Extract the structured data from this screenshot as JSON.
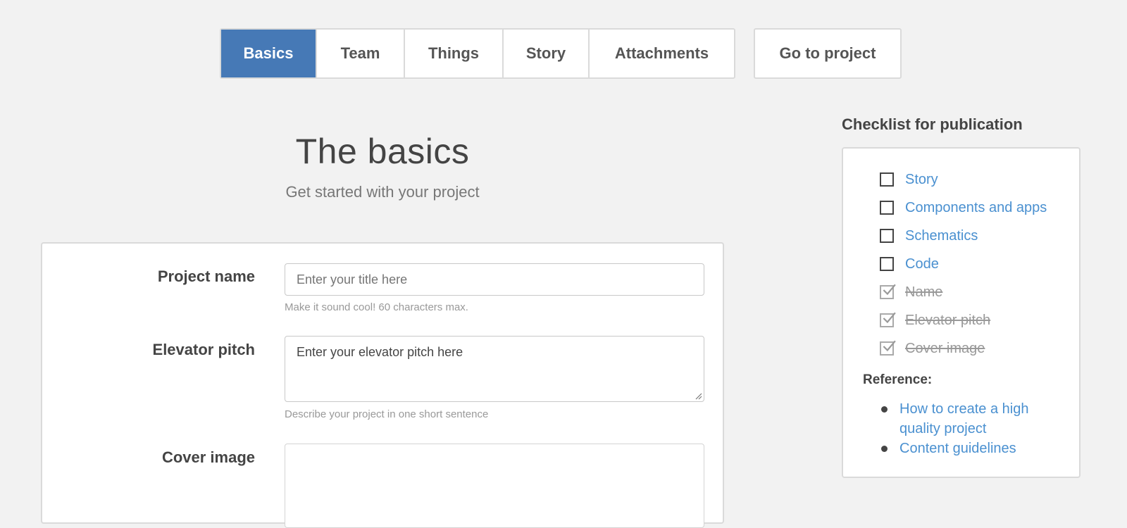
{
  "nav": {
    "tabs": [
      {
        "label": "Basics",
        "active": true
      },
      {
        "label": "Team",
        "active": false
      },
      {
        "label": "Things",
        "active": false
      },
      {
        "label": "Story",
        "active": false
      },
      {
        "label": "Attachments",
        "active": false
      }
    ],
    "goto_label": "Go to project"
  },
  "header": {
    "title": "The basics",
    "subtitle": "Get started with your project"
  },
  "form": {
    "project_name": {
      "label": "Project name",
      "placeholder": "Enter your title here",
      "value": "",
      "hint": "Make it sound cool! 60 characters max."
    },
    "elevator_pitch": {
      "label": "Elevator pitch",
      "placeholder": "Enter your elevator pitch here",
      "value": "",
      "hint": "Describe your project in one short sentence"
    },
    "cover_image": {
      "label": "Cover image"
    }
  },
  "checklist": {
    "title": "Checklist for publication",
    "items": [
      {
        "label": "Story",
        "done": false
      },
      {
        "label": "Components and apps",
        "done": false
      },
      {
        "label": "Schematics",
        "done": false
      },
      {
        "label": "Code",
        "done": false
      },
      {
        "label": "Name",
        "done": true
      },
      {
        "label": "Elevator pitch",
        "done": true
      },
      {
        "label": "Cover image",
        "done": true
      }
    ],
    "reference_title": "Reference:",
    "references": [
      {
        "label": "How to create a high quality project"
      },
      {
        "label": "Content guidelines"
      }
    ]
  },
  "colors": {
    "accent": "#4679b6",
    "link": "#4a90d0",
    "background": "#f2f2f2"
  }
}
